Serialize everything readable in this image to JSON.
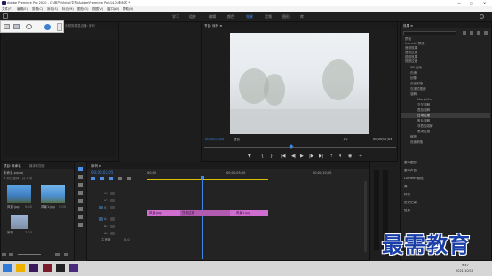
{
  "window": {
    "title": "Adobe Premiere Pro 2020 - C:\\用户\\Video\\文档\\Adobe\\Premiere Pro\\14.0\\未命名 *",
    "controls": [
      "—",
      "□",
      "✕"
    ]
  },
  "menu": [
    "文件(F)",
    "编辑(E)",
    "剪辑(C)",
    "序列(S)",
    "标记(M)",
    "图形(G)",
    "视图(V)",
    "窗口(W)",
    "帮助(H)"
  ],
  "workspaces": [
    {
      "label": "学习",
      "active": false
    },
    {
      "label": "组件",
      "active": false
    },
    {
      "label": "编辑",
      "active": false
    },
    {
      "label": "颜色",
      "active": false
    },
    {
      "label": "效果",
      "active": true
    },
    {
      "label": "音频",
      "active": false
    },
    {
      "label": "图形",
      "active": false
    },
    {
      "label": "库",
      "active": false
    }
  ],
  "source_panel": {
    "tabs": [
      "源：(无剪辑)",
      "效果控件 ≡",
      "音频剪辑混合器: 序列",
      "元数据"
    ],
    "title": "音频剪辑混合器：序列"
  },
  "program": {
    "tab": "节目: 序列 ≡",
    "timecode": "00;00;03;05",
    "fit": "适合",
    "ratio": "1/2",
    "duration": "00;00;07;03"
  },
  "effects": {
    "tab": "效果 ≡",
    "search_placeholder": "",
    "items": [
      {
        "label": "预设",
        "level": 0,
        "selected": false
      },
      {
        "label": "Lumetri 预设",
        "level": 0,
        "selected": false
      },
      {
        "label": "音频效果",
        "level": 0,
        "selected": false
      },
      {
        "label": "音频过渡",
        "level": 0,
        "selected": false
      },
      {
        "label": "视频效果",
        "level": 0,
        "selected": false
      },
      {
        "label": "视频过渡",
        "level": 0,
        "selected": false
      },
      {
        "label": "3D 运动",
        "level": 1,
        "selected": false
      },
      {
        "label": "内滑",
        "level": 1,
        "selected": false
      },
      {
        "label": "划像",
        "level": 1,
        "selected": false
      },
      {
        "label": "页面剥落",
        "level": 1,
        "selected": false
      },
      {
        "label": "沉浸式视频",
        "level": 1,
        "selected": false
      },
      {
        "label": "溶解",
        "level": 1,
        "selected": false
      },
      {
        "label": "MorphCut",
        "level": 2,
        "selected": false
      },
      {
        "label": "交叉溶解",
        "level": 2,
        "selected": false
      },
      {
        "label": "叠加溶解",
        "level": 2,
        "selected": false
      },
      {
        "label": "白场过渡",
        "level": 2,
        "selected": true
      },
      {
        "label": "胶片溶解",
        "level": 2,
        "selected": false
      },
      {
        "label": "非叠加溶解",
        "level": 2,
        "selected": false
      },
      {
        "label": "黑场过渡",
        "level": 2,
        "selected": false
      },
      {
        "label": "缩放",
        "level": 1,
        "selected": false
      },
      {
        "label": "页面剥落",
        "level": 1,
        "selected": false
      }
    ],
    "sections": [
      "基本图形",
      "基本声音",
      "Lumetri 颜色",
      "库",
      "标记",
      "历史记录",
      "信息"
    ]
  },
  "project": {
    "tabs": [
      "项目: 未命名",
      "媒体浏览器"
    ],
    "name": "未命名.prproj",
    "count": "3 项已选择，共 4 项",
    "items": [
      {
        "label": "风景.jpg",
        "meta": "5:00"
      },
      {
        "label": "风景1.jpg",
        "meta": "5:00"
      },
      {
        "label": "序列",
        "meta": "7:03"
      }
    ]
  },
  "timeline": {
    "tab": "序列 ≡",
    "timecode": "00;00;03;05",
    "ruler": [
      "00;00",
      "00;00;05;00",
      "00;00;10;00"
    ],
    "tracks": [
      {
        "name": "V3",
        "label": "V3"
      },
      {
        "name": "V2",
        "label": "V2"
      },
      {
        "name": "V1",
        "label": "V1"
      },
      {
        "name": "A1",
        "label": "A1"
      },
      {
        "name": "A2",
        "label": "A2"
      },
      {
        "name": "A3",
        "label": "A3"
      }
    ],
    "master": "主声道",
    "master_value": "0.0",
    "clips": [
      {
        "label": "风景.jpg"
      },
      {
        "label": "白场过渡"
      },
      {
        "label": "风景1.jpg"
      }
    ]
  },
  "taskbar": {
    "time": "9:47",
    "date": "2021/10/15"
  },
  "watermark": "最需教育"
}
